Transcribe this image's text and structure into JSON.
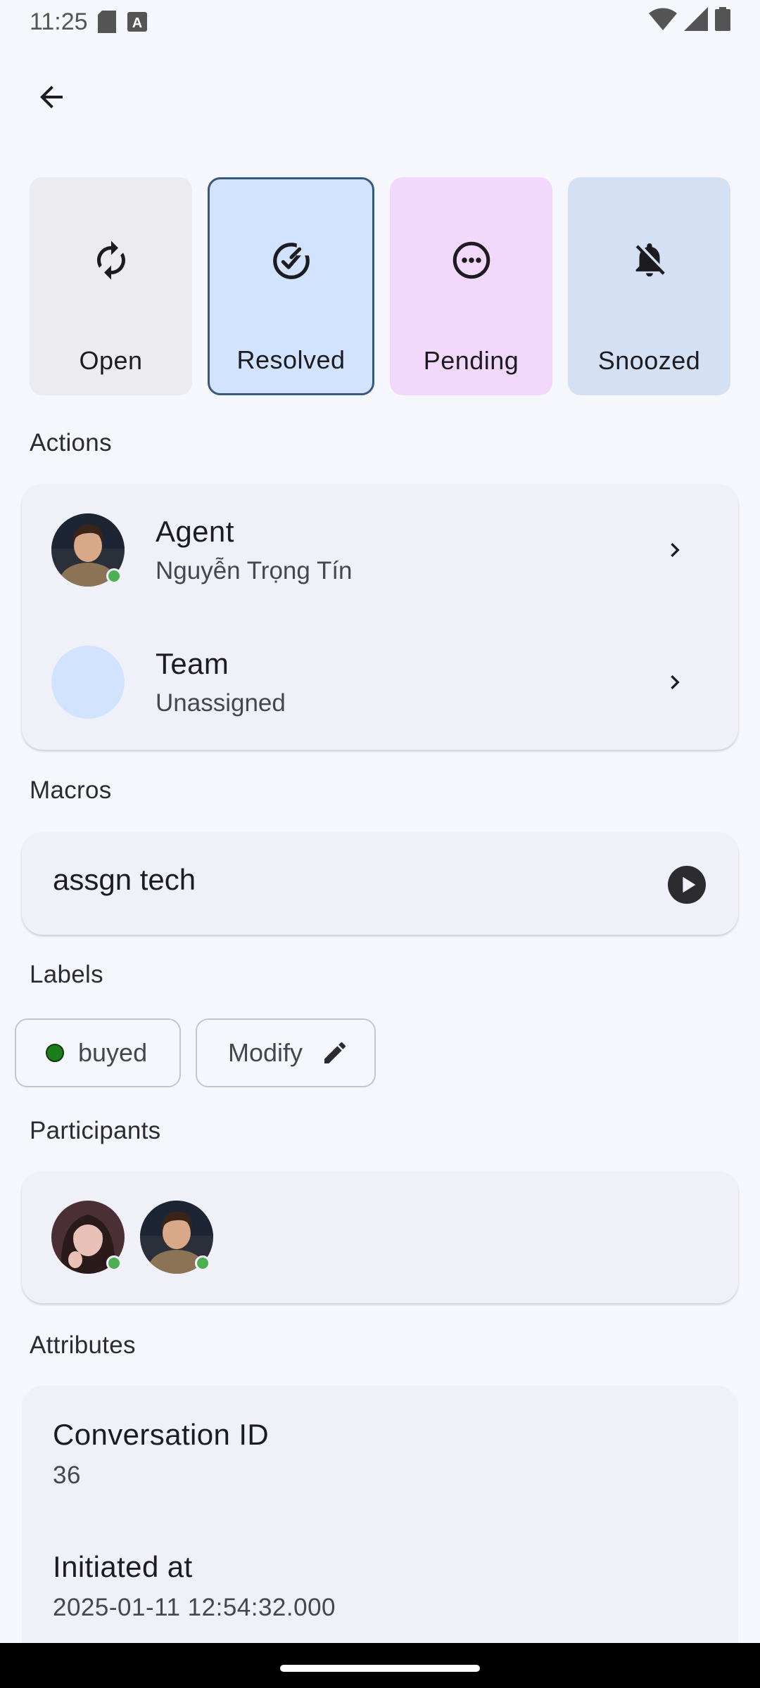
{
  "status_bar": {
    "time": "11:25"
  },
  "statuses": [
    {
      "label": "Open",
      "icon": "sync-icon"
    },
    {
      "label": "Resolved",
      "icon": "check-circle-icon",
      "selected": true
    },
    {
      "label": "Pending",
      "icon": "more-circle-icon"
    },
    {
      "label": "Snoozed",
      "icon": "bell-off-icon"
    }
  ],
  "sections": {
    "actions": "Actions",
    "macros": "Macros",
    "labels": "Labels",
    "participants": "Participants",
    "attributes": "Attributes"
  },
  "actions": {
    "agent": {
      "title": "Agent",
      "value": "Nguyễn Trọng Tín"
    },
    "team": {
      "title": "Team",
      "value": "Unassigned"
    }
  },
  "macros": [
    {
      "name": "assgn tech"
    }
  ],
  "labels": {
    "items": [
      {
        "name": "buyed",
        "color": "#1b7e1b"
      }
    ],
    "modify_label": "Modify"
  },
  "attributes": [
    {
      "title": "Conversation ID",
      "value": "36"
    },
    {
      "title": "Initiated at",
      "value": "2025-01-11 12:54:32.000"
    }
  ],
  "colors": {
    "resolved_bg": "#d1e3ff",
    "pending_bg": "#f2d9fb",
    "snoozed_bg": "#d4e1f5",
    "online": "#4caf50"
  }
}
